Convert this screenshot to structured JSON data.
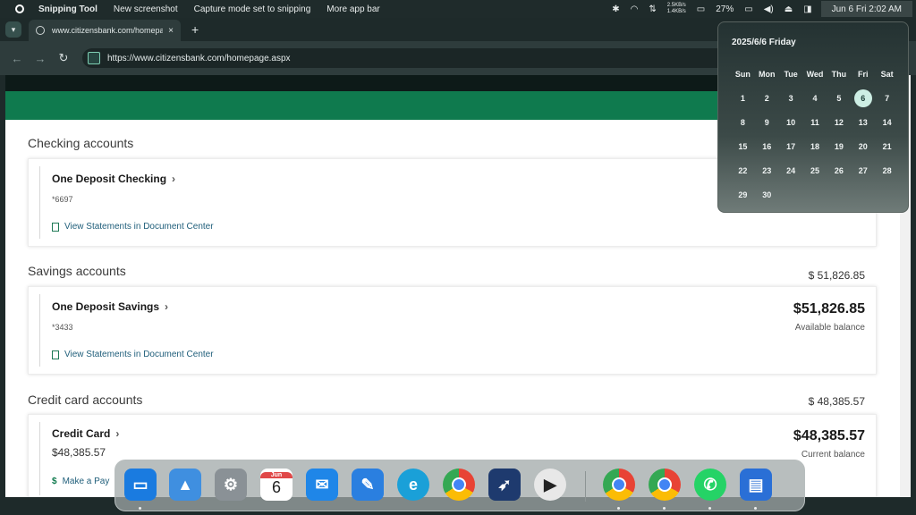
{
  "menubar": {
    "app_name": "Snipping Tool",
    "items": [
      "New screenshot",
      "Capture mode set to snipping",
      "More app bar"
    ],
    "network_up": "2.5KB/s",
    "network_down": "1.4KB/s",
    "battery": "27%",
    "clock": "Jun 6 Fri 2:02 AM"
  },
  "browser": {
    "tab_title": "www.citizensbank.com/homepa",
    "tab_close": "×",
    "new_tab": "+",
    "url": "https://www.citizensbank.com/homepage.aspx"
  },
  "page": {
    "checking": {
      "section_title": "Checking accounts",
      "account_name": "One Deposit Checking",
      "chevron": "›",
      "account_number": "*6697",
      "link": "View Statements in Document Center"
    },
    "savings": {
      "section_title": "Savings accounts",
      "section_total": "$ 51,826.85",
      "account_name": "One Deposit Savings",
      "chevron": "›",
      "account_number": "*3433",
      "link": "View Statements in Document Center",
      "balance": "$51,826.85",
      "balance_label": "Available balance"
    },
    "credit": {
      "section_title": "Credit card accounts",
      "section_total": "$ 48,385.57",
      "account_name": "Credit Card",
      "chevron": "›",
      "card_balance": "$48,385.57",
      "link": "Make a Pay",
      "balance": "$48,385.57",
      "balance_label": "Current balance"
    }
  },
  "calendar": {
    "header": "2025/6/6 Friday",
    "weekdays": [
      "Sun",
      "Mon",
      "Tue",
      "Wed",
      "Thu",
      "Fri",
      "Sat"
    ],
    "weeks": [
      [
        "1",
        "2",
        "3",
        "4",
        "5",
        "6",
        "7"
      ],
      [
        "8",
        "9",
        "10",
        "11",
        "12",
        "13",
        "14"
      ],
      [
        "15",
        "16",
        "17",
        "18",
        "19",
        "20",
        "21"
      ],
      [
        "22",
        "23",
        "24",
        "25",
        "26",
        "27",
        "28"
      ],
      [
        "29",
        "30",
        "",
        "",
        "",
        "",
        ""
      ]
    ],
    "today": "6"
  },
  "dock": {
    "calendar_month": "Jun",
    "calendar_day": "6",
    "icons": [
      "monitor-icon",
      "photos-icon",
      "settings-icon",
      "calendar-icon",
      "mail-icon",
      "pen-icon",
      "edge-icon",
      "chrome-icon",
      "rocket-icon",
      "media-player-icon",
      "chrome-icon",
      "chrome-icon",
      "whatsapp-icon",
      "notes-icon"
    ]
  }
}
